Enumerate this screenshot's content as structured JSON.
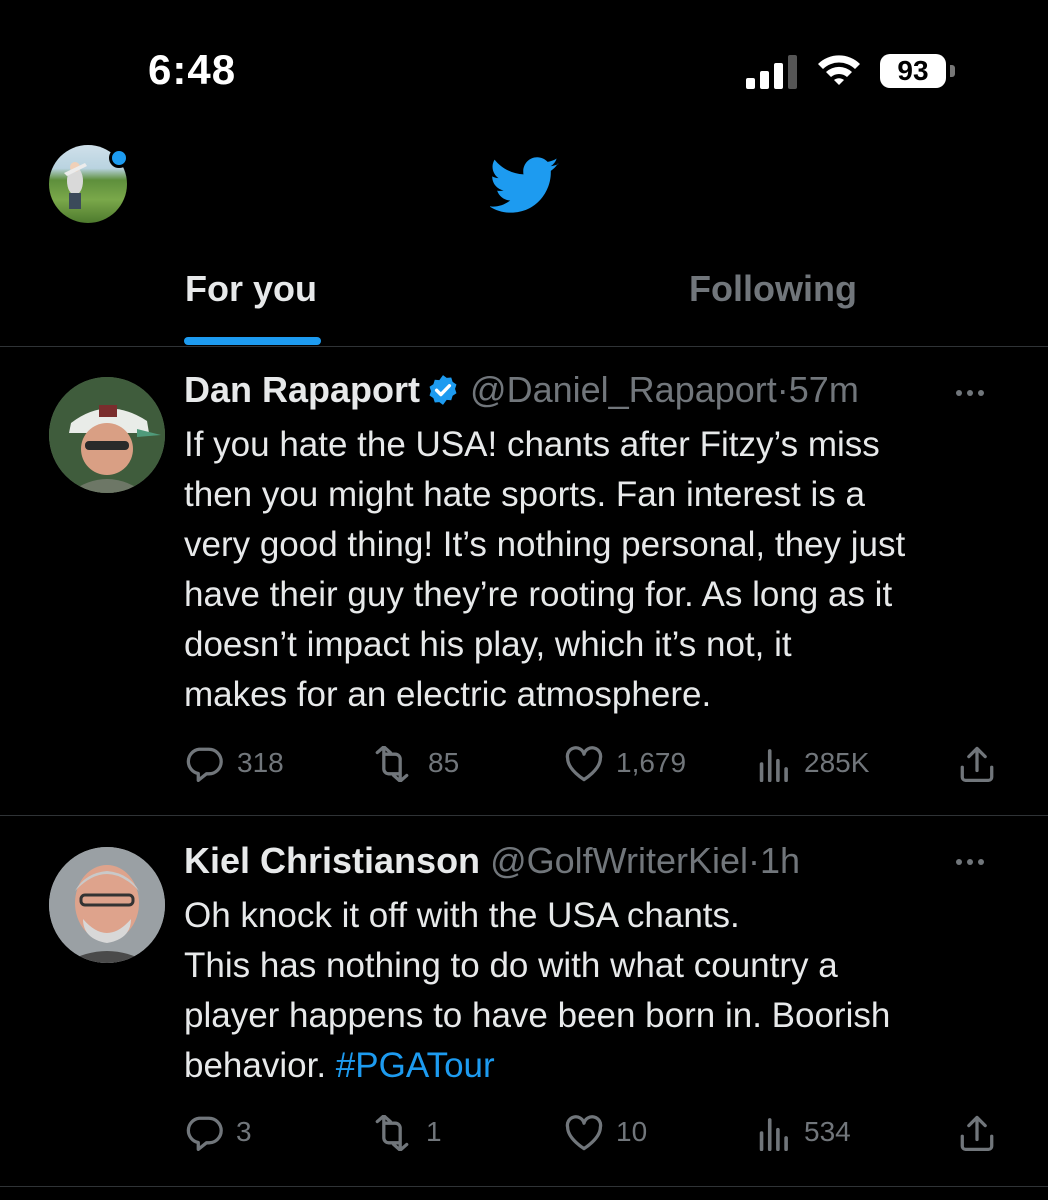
{
  "status_bar": {
    "time": "6:48",
    "battery": "93"
  },
  "topbar": {
    "profile_icon": "user-avatar",
    "logo_icon": "twitter-bird-icon",
    "accent": "#1d9bf0"
  },
  "tabs": [
    {
      "label": "For you",
      "active": true
    },
    {
      "label": "Following",
      "active": false
    }
  ],
  "tweets": [
    {
      "name": "Dan Rapaport",
      "verified": true,
      "handle": "@Daniel_Rapaport",
      "separator": "·",
      "time": "57m",
      "lines": [
        "If you hate the USA! chants after Fitzy’s miss",
        "then you might hate sports. Fan interest is a",
        "very good thing! It’s nothing personal, they just",
        "have their guy they’re rooting for. As long as it",
        "doesn’t impact his play, which it’s not, it",
        "makes for an electric atmosphere."
      ],
      "replies": "318",
      "retweets": "85",
      "likes": "1,679",
      "views": "285K"
    },
    {
      "name": "Kiel Christianson",
      "verified": false,
      "handle": "@GolfWriterKiel",
      "separator": "·",
      "time": "1h",
      "lines": [
        "Oh knock it off with the USA chants.",
        "This has nothing to do with what country a",
        "player happens to have been born in. Boorish",
        "behavior."
      ],
      "hashtag": "#PGATour",
      "replies": "3",
      "retweets": "1",
      "likes": "10",
      "views": "534"
    }
  ]
}
